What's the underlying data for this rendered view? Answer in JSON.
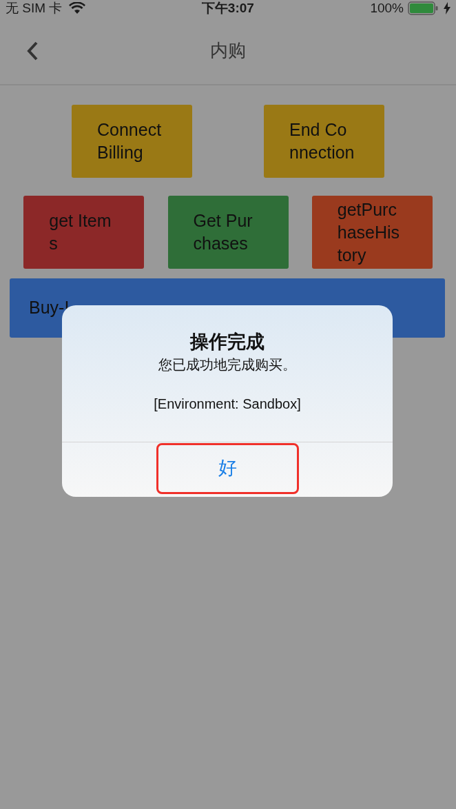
{
  "status_bar": {
    "carrier": "无 SIM 卡",
    "time": "下午3:07",
    "battery": "100%"
  },
  "nav": {
    "title": "内购"
  },
  "button_rows": [
    [
      {
        "label": "Connect Billing",
        "color": "#9a7915"
      },
      {
        "label": "End Connection",
        "color": "#9a7915"
      }
    ],
    [
      {
        "label": "get Items",
        "color": "#8c2828"
      },
      {
        "label": "Get Purchases",
        "color": "#2f6e38"
      },
      {
        "label": "getPurchaseHistory",
        "color": "#9a3a1e"
      }
    ]
  ],
  "buy_bar": {
    "label": "Buy-I"
  },
  "alert": {
    "title": "操作完成",
    "message": "您已成功地完成购买。",
    "environment": "[Environment: Sandbox]",
    "button": "好"
  }
}
